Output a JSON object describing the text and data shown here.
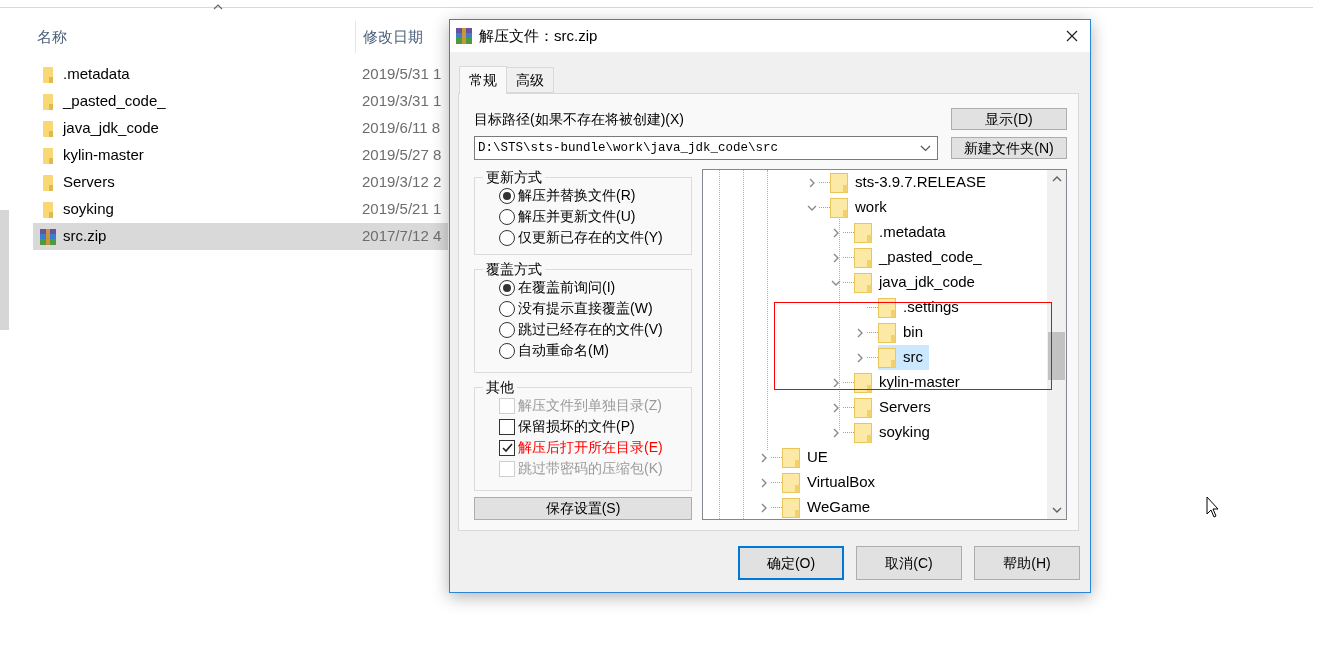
{
  "explorer": {
    "columns": [
      {
        "label": "名称"
      },
      {
        "label": "修改日期"
      }
    ],
    "rows": [
      {
        "kind": "folder",
        "name": ".metadata",
        "date": "2019/5/31 1",
        "selected": false
      },
      {
        "kind": "folder",
        "name": "_pasted_code_",
        "date": "2019/3/31 1",
        "selected": false
      },
      {
        "kind": "folder",
        "name": "java_jdk_code",
        "date": "2019/6/11 8",
        "selected": false
      },
      {
        "kind": "folder",
        "name": "kylin-master",
        "date": "2019/5/27 8",
        "selected": false
      },
      {
        "kind": "folder",
        "name": "Servers",
        "date": "2019/3/12 2",
        "selected": false
      },
      {
        "kind": "folder",
        "name": "soyking",
        "date": "2019/5/21 1",
        "selected": false
      },
      {
        "kind": "archive",
        "name": "src.zip",
        "date": "2017/7/12 4",
        "selected": true
      }
    ]
  },
  "dialog": {
    "title": "解压文件：src.zip",
    "tabs": [
      {
        "label": "常规",
        "selected": true
      },
      {
        "label": "高级",
        "selected": false
      }
    ],
    "path_label": "目标路径(如果不存在将被创建)(X)",
    "path_value": "D:\\STS\\sts-bundle\\work\\java_jdk_code\\src",
    "show_button": "显示(D)",
    "new_folder_button": "新建文件夹(N)",
    "groups": [
      {
        "title": "更新方式",
        "options": [
          {
            "kind": "radio",
            "label": "解压并替换文件(R)",
            "selected": true
          },
          {
            "kind": "radio",
            "label": "解压并更新文件(U)",
            "selected": false
          },
          {
            "kind": "radio",
            "label": "仅更新已存在的文件(Y)",
            "selected": false
          }
        ]
      },
      {
        "title": "覆盖方式",
        "options": [
          {
            "kind": "radio",
            "label": "在覆盖前询问(I)",
            "selected": true
          },
          {
            "kind": "radio",
            "label": "没有提示直接覆盖(W)",
            "selected": false
          },
          {
            "kind": "radio",
            "label": "跳过已经存在的文件(V)",
            "selected": false
          },
          {
            "kind": "radio",
            "label": "自动重命名(M)",
            "selected": false
          }
        ]
      },
      {
        "title": "其他",
        "options": [
          {
            "kind": "checkbox",
            "label": "解压文件到单独目录(Z)",
            "checked": false,
            "disabled": true,
            "emphasized": false
          },
          {
            "kind": "checkbox",
            "label": "保留损坏的文件(P)",
            "checked": false,
            "disabled": false,
            "emphasized": false
          },
          {
            "kind": "checkbox",
            "label": "解压后打开所在目录(E)",
            "checked": true,
            "disabled": false,
            "emphasized": true
          },
          {
            "kind": "checkbox",
            "label": "跳过带密码的压缩包(K)",
            "checked": false,
            "disabled": true,
            "emphasized": false
          }
        ]
      }
    ],
    "save_button": "保存设置(S)",
    "tree": [
      {
        "children": [
          {
            "children": [
              {
                "label": "sts-3.9.7.RELEASE",
                "expandable": true,
                "expanded": false,
                "selected": false
              },
              {
                "label": "work",
                "expandable": true,
                "expanded": true,
                "selected": false,
                "children": [
                  {
                    "label": ".metadata",
                    "expandable": true,
                    "expanded": false,
                    "selected": false
                  },
                  {
                    "label": "_pasted_code_",
                    "expandable": true,
                    "expanded": false,
                    "selected": false
                  },
                  {
                    "label": "java_jdk_code",
                    "expandable": true,
                    "expanded": true,
                    "selected": false,
                    "children": [
                      {
                        "label": ".settings",
                        "expandable": false,
                        "selected": false
                      },
                      {
                        "label": "bin",
                        "expandable": true,
                        "expanded": false,
                        "selected": false
                      },
                      {
                        "label": "src",
                        "expandable": true,
                        "expanded": false,
                        "selected": true
                      }
                    ]
                  },
                  {
                    "label": "kylin-master",
                    "expandable": true,
                    "expanded": false,
                    "selected": false
                  },
                  {
                    "label": "Servers",
                    "expandable": true,
                    "expanded": false,
                    "selected": false
                  },
                  {
                    "label": "soyking",
                    "expandable": true,
                    "expanded": false,
                    "selected": false
                  }
                ]
              }
            ]
          }
        ]
      },
      {
        "label": "UE",
        "expandable": true,
        "expanded": false,
        "selected": false
      },
      {
        "label": "VirtualBox",
        "expandable": true,
        "expanded": false,
        "selected": false
      },
      {
        "label": "WeGame",
        "expandable": true,
        "expanded": false,
        "selected": false
      }
    ],
    "buttons": [
      {
        "label": "确定(O)",
        "default": true
      },
      {
        "label": "取消(C)",
        "default": false
      },
      {
        "label": "帮助(H)",
        "default": false
      }
    ]
  }
}
